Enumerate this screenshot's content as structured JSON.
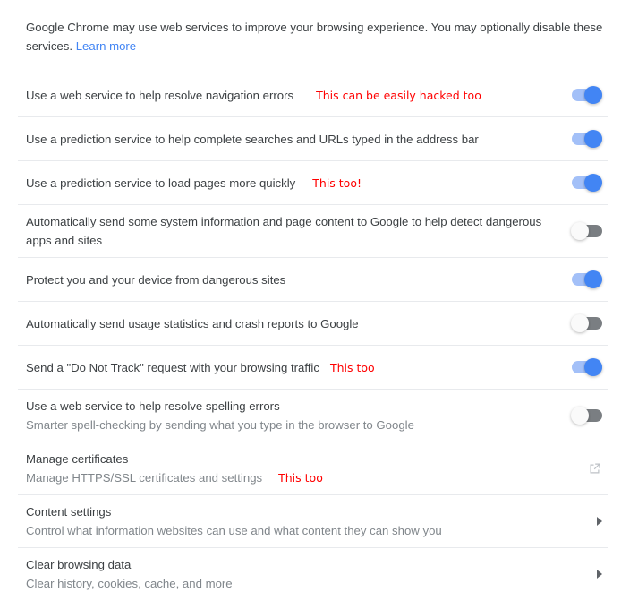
{
  "intro": {
    "text": "Google Chrome may use web services to improve your browsing experience. You may optionally disable these services.",
    "link_label": "Learn more"
  },
  "colors": {
    "toggle_on_track": "#a3c0f8",
    "toggle_on_knob": "#4285f4",
    "toggle_off_track": "#7a7e82",
    "toggle_off_knob": "#fafafa",
    "link": "#4285f4",
    "annotation": "#ff0000",
    "primary_text": "#3c4043",
    "secondary_text": "#80868b",
    "divider": "#e8eaed"
  },
  "rows": [
    {
      "title": "Use a web service to help resolve navigation errors",
      "sub": "",
      "annotation": "This can be easily hacked too",
      "annotation_gap": 25,
      "control": "toggle",
      "state": "on",
      "icon_name": "toggle-switch"
    },
    {
      "title": "Use a prediction service to help complete searches and URLs typed in the address bar",
      "sub": "",
      "annotation": "",
      "annotation_gap": 0,
      "control": "toggle",
      "state": "on",
      "icon_name": "toggle-switch"
    },
    {
      "title": "Use a prediction service to load pages more quickly",
      "sub": "",
      "annotation": "This too!",
      "annotation_gap": 19,
      "control": "toggle",
      "state": "on",
      "icon_name": "toggle-switch"
    },
    {
      "title": "Automatically send some system information and page content to Google to help detect dangerous apps and sites",
      "sub": "",
      "annotation": "",
      "annotation_gap": 0,
      "control": "toggle",
      "state": "off",
      "icon_name": "toggle-switch"
    },
    {
      "title": "Protect you and your device from dangerous sites",
      "sub": "",
      "annotation": "",
      "annotation_gap": 0,
      "control": "toggle",
      "state": "on",
      "icon_name": "toggle-switch"
    },
    {
      "title": "Automatically send usage statistics and crash reports to Google",
      "sub": "",
      "annotation": "",
      "annotation_gap": 0,
      "control": "toggle",
      "state": "off",
      "icon_name": "toggle-switch"
    },
    {
      "title": "Send a \"Do Not Track\" request with your browsing traffic",
      "sub": "",
      "annotation": "This too",
      "annotation_gap": 12,
      "control": "toggle",
      "state": "on",
      "icon_name": "toggle-switch"
    },
    {
      "title": "Use a web service to help resolve spelling errors",
      "sub": "Smarter spell-checking by sending what you type in the browser to Google",
      "annotation": "",
      "annotation_gap": 0,
      "control": "toggle",
      "state": "off",
      "icon_name": "toggle-switch"
    },
    {
      "title": "Manage certificates",
      "sub": "Manage HTTPS/SSL certificates and settings",
      "annotation": "This too",
      "annotation_gap": 18,
      "annotation_on_sub": true,
      "control": "external",
      "state": "",
      "icon_name": "external-link-icon"
    },
    {
      "title": "Content settings",
      "sub": "Control what information websites can use and what content they can show you",
      "annotation": "",
      "annotation_gap": 0,
      "control": "chevron",
      "state": "",
      "icon_name": "chevron-right-icon"
    },
    {
      "title": "Clear browsing data",
      "sub": "Clear history, cookies, cache, and more",
      "annotation": "",
      "annotation_gap": 0,
      "control": "chevron",
      "state": "",
      "icon_name": "chevron-right-icon"
    }
  ]
}
